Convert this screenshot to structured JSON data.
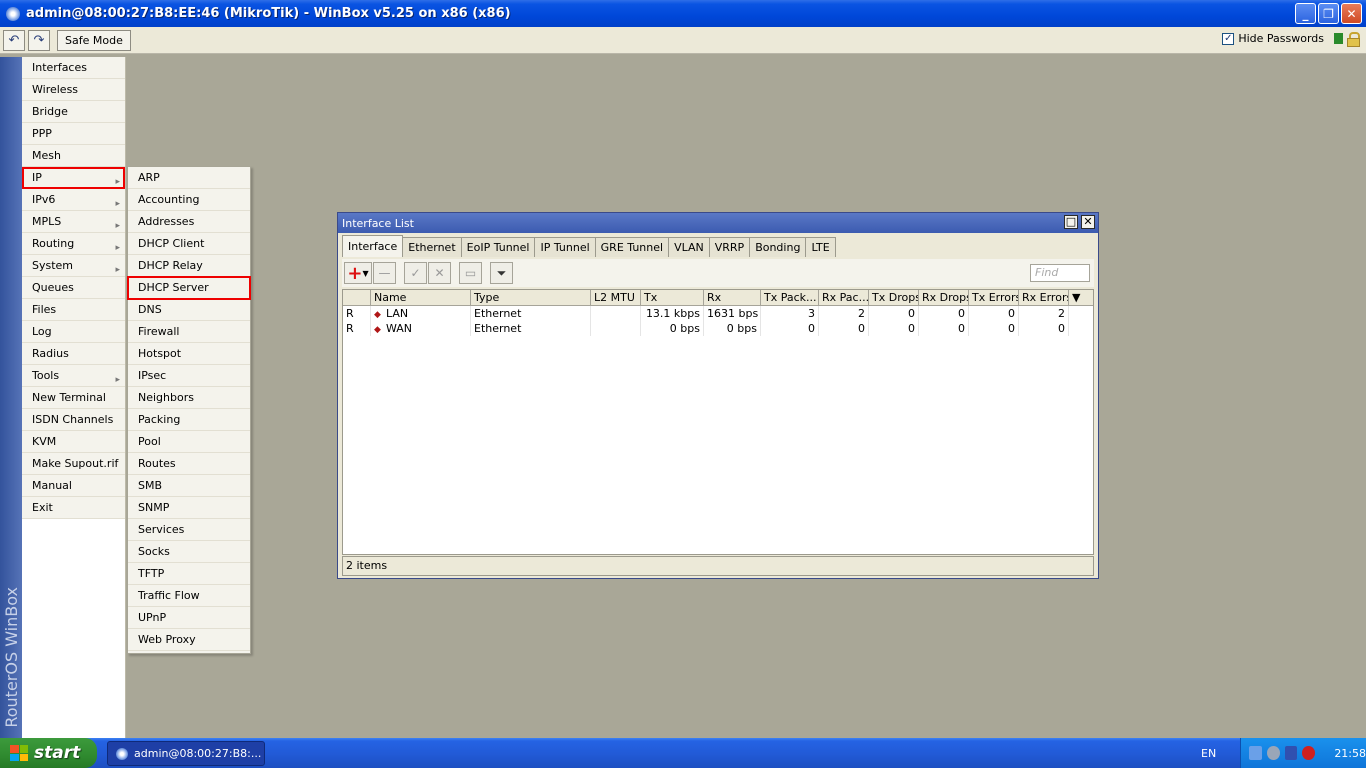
{
  "window": {
    "title": "admin@08:00:27:B8:EE:46 (MikroTik) - WinBox v5.25 on x86 (x86)"
  },
  "toolbar": {
    "safe_mode": "Safe Mode",
    "hide_passwords": "Hide Passwords",
    "hide_passwords_checked": true
  },
  "brand": {
    "vertical": "RouterOS WinBox"
  },
  "main_menu": [
    {
      "label": "Interfaces"
    },
    {
      "label": "Wireless"
    },
    {
      "label": "Bridge"
    },
    {
      "label": "PPP"
    },
    {
      "label": "Mesh"
    },
    {
      "label": "IP",
      "submenu": true,
      "highlighted": true
    },
    {
      "label": "IPv6",
      "submenu": true
    },
    {
      "label": "MPLS",
      "submenu": true
    },
    {
      "label": "Routing",
      "submenu": true
    },
    {
      "label": "System",
      "submenu": true
    },
    {
      "label": "Queues"
    },
    {
      "label": "Files"
    },
    {
      "label": "Log"
    },
    {
      "label": "Radius"
    },
    {
      "label": "Tools",
      "submenu": true
    },
    {
      "label": "New Terminal"
    },
    {
      "label": "ISDN Channels"
    },
    {
      "label": "KVM"
    },
    {
      "label": "Make Supout.rif"
    },
    {
      "label": "Manual"
    },
    {
      "label": "Exit"
    }
  ],
  "ip_submenu": [
    {
      "label": "ARP"
    },
    {
      "label": "Accounting"
    },
    {
      "label": "Addresses"
    },
    {
      "label": "DHCP Client"
    },
    {
      "label": "DHCP Relay"
    },
    {
      "label": "DHCP Server",
      "highlighted": true
    },
    {
      "label": "DNS"
    },
    {
      "label": "Firewall"
    },
    {
      "label": "Hotspot"
    },
    {
      "label": "IPsec"
    },
    {
      "label": "Neighbors"
    },
    {
      "label": "Packing"
    },
    {
      "label": "Pool"
    },
    {
      "label": "Routes"
    },
    {
      "label": "SMB"
    },
    {
      "label": "SNMP"
    },
    {
      "label": "Services"
    },
    {
      "label": "Socks"
    },
    {
      "label": "TFTP"
    },
    {
      "label": "Traffic Flow"
    },
    {
      "label": "UPnP"
    },
    {
      "label": "Web Proxy"
    }
  ],
  "interface_list": {
    "title": "Interface List",
    "tabs": [
      "Interface",
      "Ethernet",
      "EoIP Tunnel",
      "IP Tunnel",
      "GRE Tunnel",
      "VLAN",
      "VRRP",
      "Bonding",
      "LTE"
    ],
    "active_tab": "Interface",
    "find_placeholder": "Find",
    "columns": [
      "",
      "Name",
      "Type",
      "L2 MTU",
      "Tx",
      "Rx",
      "Tx Pack...",
      "Rx Pac...",
      "Tx Drops",
      "Rx Drops",
      "Tx Errors",
      "Rx Errors"
    ],
    "rows": [
      {
        "flag": "R",
        "name": "LAN",
        "type": "Ethernet",
        "l2mtu": "",
        "tx": "13.1 kbps",
        "rx": "1631 bps",
        "tx_packets": "3",
        "rx_packets": "2",
        "tx_drops": "0",
        "rx_drops": "0",
        "tx_errors": "0",
        "rx_errors": "2"
      },
      {
        "flag": "R",
        "name": "WAN",
        "type": "Ethernet",
        "l2mtu": "",
        "tx": "0 bps",
        "rx": "0 bps",
        "tx_packets": "0",
        "rx_packets": "0",
        "tx_drops": "0",
        "rx_drops": "0",
        "tx_errors": "0",
        "rx_errors": "0"
      }
    ],
    "status": "2 items"
  },
  "taskbar": {
    "start": "start",
    "task": "admin@08:00:27:B8:...",
    "lang": "EN",
    "clock": "21:58"
  },
  "colors": {
    "highlight": "#e00000",
    "titlebar": "#0047d9"
  }
}
